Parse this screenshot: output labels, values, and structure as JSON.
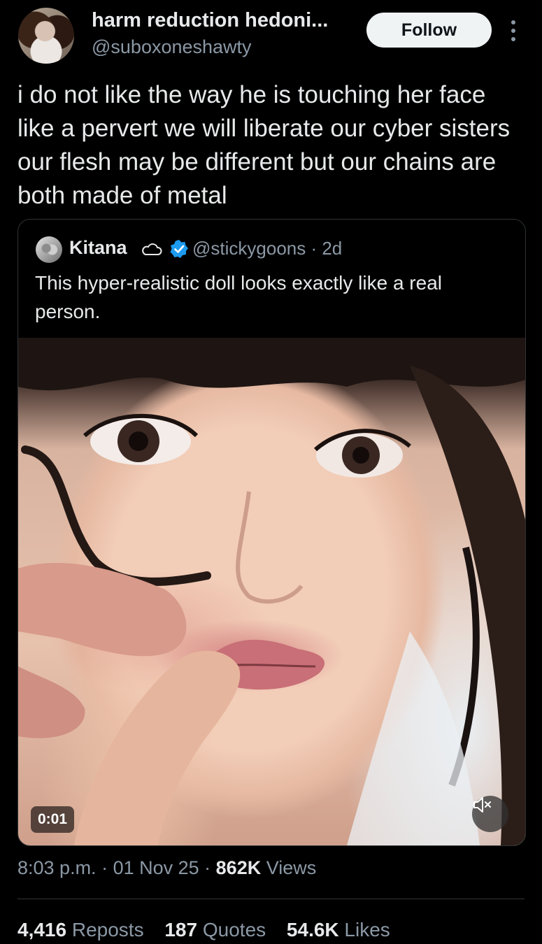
{
  "author": {
    "display_name": "harm reduction hedoni...",
    "handle": "@suboxoneshawty",
    "follow_label": "Follow"
  },
  "tweet": {
    "text": "i do not like the way he is touching her face like a pervert we will liberate our cyber sisters our flesh may be different but our chains are both made of metal"
  },
  "quoted": {
    "name": "Kitana",
    "handle_time": "@stickygoons · 2d",
    "text": "This hyper-realistic doll looks exactly like a real person.",
    "video_timestamp": "0:01"
  },
  "meta": {
    "time": "8:03 p.m.",
    "separator1": " · ",
    "date": "01 Nov 25",
    "separator2": " · ",
    "views_count": "862K",
    "views_label": " Views"
  },
  "stats": {
    "reposts_count": "4,416",
    "reposts_label": "Reposts",
    "quotes_count": "187",
    "quotes_label": "Quotes",
    "likes_count": "54.6K",
    "likes_label": "Likes"
  },
  "colors": {
    "background": "#000000",
    "text": "#e7e9ea",
    "secondary": "#8b98a5",
    "verified": "#1d9bf0",
    "border": "#2f3336"
  },
  "icons": {
    "more": "more-vertical-icon",
    "cloud": "cloud-icon",
    "verified": "verified-badge-icon",
    "mute": "volume-muted-icon"
  }
}
